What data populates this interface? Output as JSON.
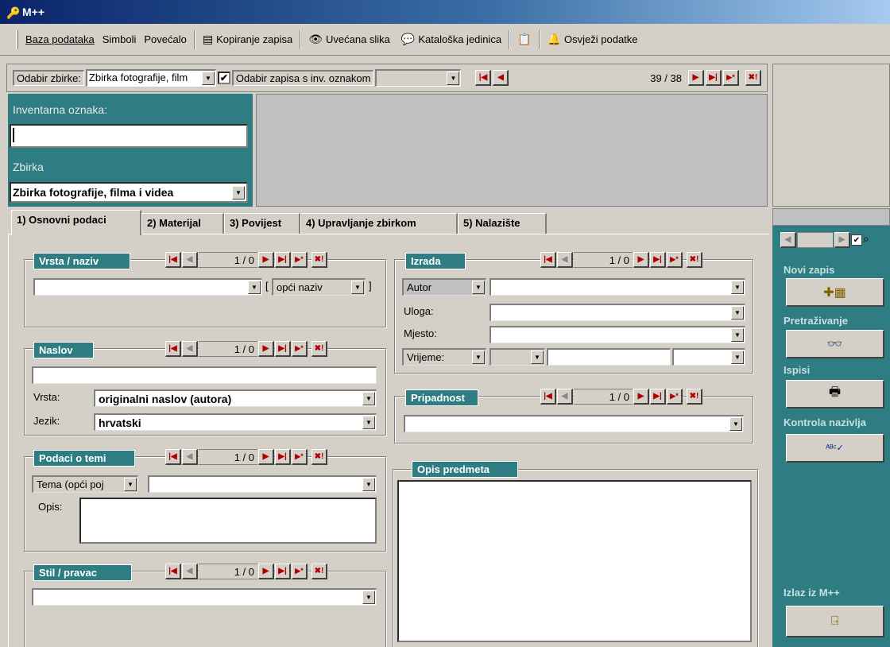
{
  "window": {
    "title": "M++"
  },
  "menu": {
    "items": [
      "Baza podataka",
      "Simboli",
      "Povećalo"
    ],
    "kopiranje": "Kopiranje zapisa",
    "uvecana": "Uvećana slika",
    "kataloska": "Kataloška jedinica",
    "osvjezi": "Osvježi podatke"
  },
  "recordbar": {
    "odabir_zbirke_label": "Odabir zbirke:",
    "odabir_zbirke_value": "Zbirka fotografije, film",
    "odabir_zapisa_label": "Odabir zapisa s inv. oznakom",
    "counter": "39 / 38"
  },
  "header": {
    "inventarna_label": "Inventarna oznaka:",
    "inventarna_value": "",
    "zbirka_label": "Zbirka",
    "zbirka_value": "Zbirka fotografije, filma i videa"
  },
  "tabs": [
    {
      "label": "1) Osnovni podaci"
    },
    {
      "label": "2) Materijal"
    },
    {
      "label": "3) Povijest"
    },
    {
      "label": "4) Upravljanje zbirkom"
    },
    {
      "label": "5) Nalazište"
    }
  ],
  "groups": {
    "vrsta": {
      "title": "Vrsta / naziv",
      "counter": "1 / 0",
      "naziv_option": "opći naziv"
    },
    "naslov": {
      "title": "Naslov",
      "counter": "1 / 0",
      "vrsta_label": "Vrsta:",
      "vrsta_value": "originalni naslov (autora)",
      "jezik_label": "Jezik:",
      "jezik_value": "hrvatski"
    },
    "tema": {
      "title": "Podaci o temi",
      "counter": "1 / 0",
      "tema_select": "Tema (opći poj",
      "opis_label": "Opis:"
    },
    "stil": {
      "title": "Stil / pravac",
      "counter": "1 / 0"
    },
    "izrada": {
      "title": "Izrada",
      "counter": "1 / 0",
      "autor_label": "Autor",
      "uloga_label": "Uloga:",
      "mjesto_label": "Mjesto:",
      "vrijeme_label": "Vrijeme:"
    },
    "pripadnost": {
      "title": "Pripadnost",
      "counter": "1 / 0"
    },
    "opis_predmeta": {
      "title": "Opis predmeta"
    }
  },
  "sidebar": {
    "novi_zapis": "Novi zapis",
    "pretrazivanje": "Pretraživanje",
    "ispisi": "Ispisi",
    "kontrola": "Kontrola nazivlja",
    "izlaz": "Izlaz iz M++"
  },
  "colors": {
    "teal": "#2e7d82",
    "face": "#d4d0c8",
    "nav_red": "#b00000"
  }
}
